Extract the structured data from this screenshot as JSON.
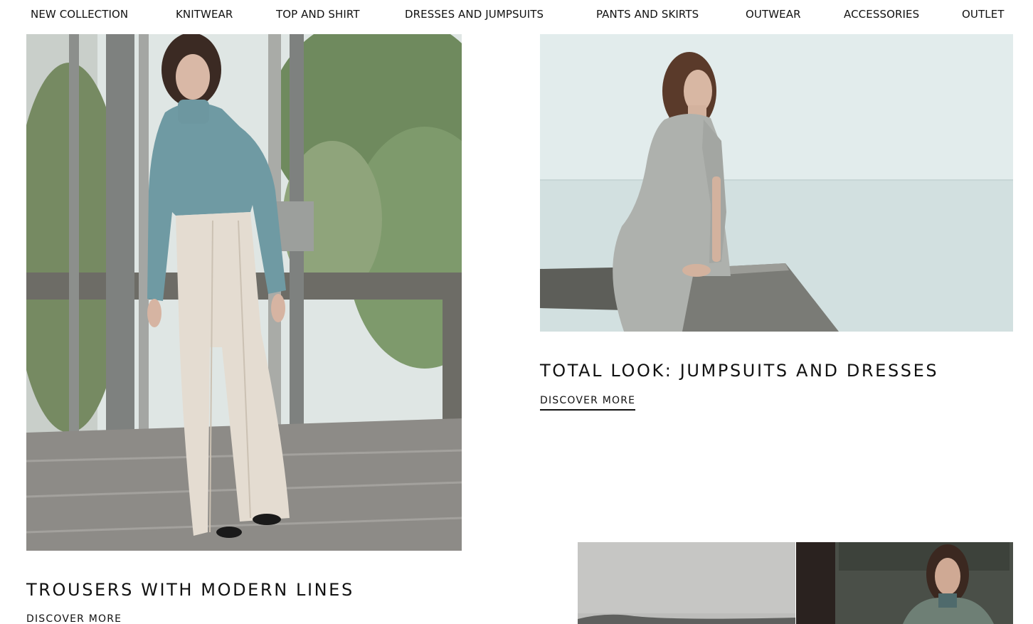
{
  "nav": {
    "items": [
      {
        "label": "NEW COLLECTION"
      },
      {
        "label": "KNITWEAR"
      },
      {
        "label": "TOP AND SHIRT"
      },
      {
        "label": "DRESSES AND JUMPSUITS"
      },
      {
        "label": "PANTS AND SKIRTS"
      },
      {
        "label": "OUTWEAR"
      },
      {
        "label": "ACCESSORIES"
      },
      {
        "label": "OUTLET"
      }
    ]
  },
  "features": [
    {
      "title": "TROUSERS WITH MODERN LINES",
      "cta": "DISCOVER MORE"
    },
    {
      "title": "TOTAL LOOK: JUMPSUITS AND DRESSES",
      "cta": "DISCOVER MORE"
    }
  ],
  "colors": {
    "text": "#111111",
    "background": "#ffffff",
    "sweater": "#6f9aa3",
    "trousers": "#e4dcd1",
    "dress": "#aeb1ad",
    "sea": "#d6e3e3"
  }
}
